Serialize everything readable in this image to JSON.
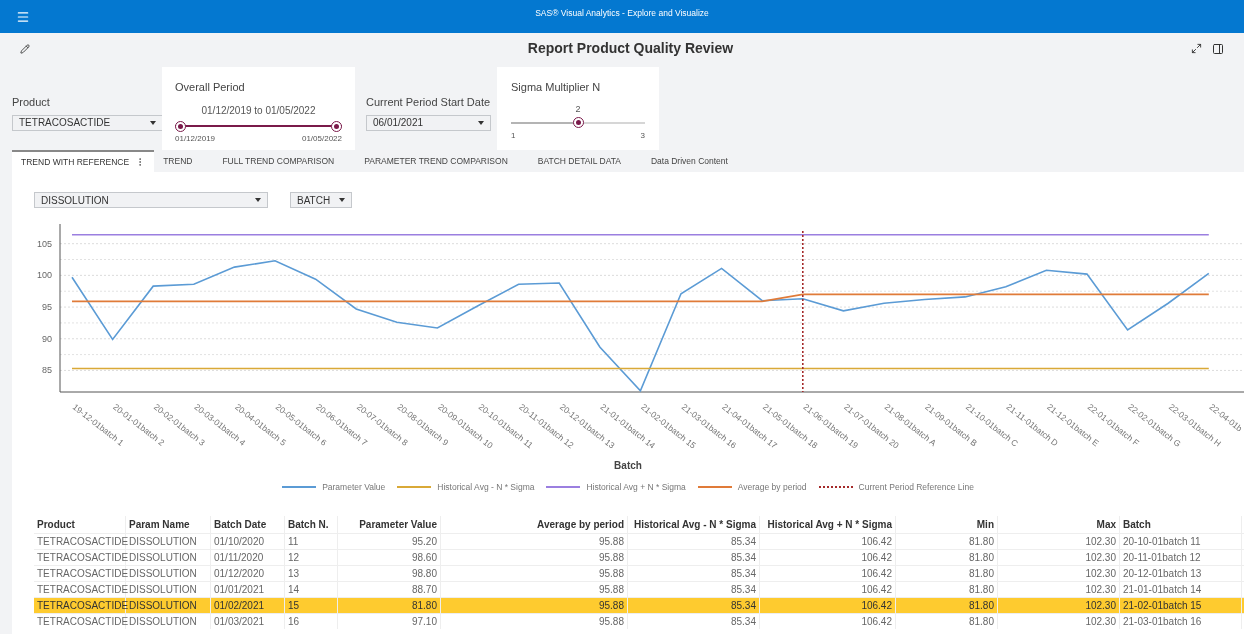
{
  "app_bar": {
    "title": "SAS® Visual Analytics - Explore and Visualize"
  },
  "report": {
    "title": "Report Product Quality Review"
  },
  "filters": {
    "product": {
      "label": "Product",
      "value": "TETRACOSACTIDE"
    },
    "overall_period": {
      "label": "Overall Period",
      "reading": "01/12/2019 to 01/05/2022",
      "min_label": "01/12/2019",
      "max_label": "01/05/2022",
      "level": 1
    },
    "current_period": {
      "label": "Current Period Start Date",
      "value": "06/01/2021"
    },
    "sigma": {
      "label": "Sigma Multiplier N",
      "reading": "2",
      "min_label": "1",
      "max_label": "3",
      "level": 0.5
    }
  },
  "tabs": [
    {
      "label": "TREND WITH REFERENCE",
      "selected": true
    },
    {
      "label": "TREND",
      "selected": false
    },
    {
      "label": "FULL TREND COMPARISON",
      "selected": false
    },
    {
      "label": "PARAMETER TREND COMPARISON",
      "selected": false
    },
    {
      "label": "BATCH DETAIL DATA",
      "selected": false
    },
    {
      "label": "Data Driven Content",
      "selected": false
    }
  ],
  "controls": {
    "parameter": "DISSOLUTION",
    "group_by": "BATCH"
  },
  "chart": {
    "chart_data": {
      "type": "line",
      "xlabel": "Batch",
      "categories": [
        "19-12-01batch 1",
        "20-01-01batch 2",
        "20-02-01batch 3",
        "20-03-01batch 4",
        "20-04-01batch 5",
        "20-05-01batch 6",
        "20-06-01batch 7",
        "20-07-01batch 8",
        "20-08-01batch 9",
        "20-09-01batch 10",
        "20-10-01batch 11",
        "20-11-01batch 12",
        "20-12-01batch 13",
        "21-01-01batch 14",
        "21-02-01batch 15",
        "21-03-01batch 16",
        "21-04-01batch 17",
        "21-05-01batch 18",
        "21-06-01batch 19",
        "21-07-01batch 20",
        "21-08-01batch A",
        "21-09-01batch B",
        "21-10-01batch C",
        "21-11-01batch D",
        "21-12-01batch E",
        "22-01-01batch F",
        "22-02-01batch G",
        "22-03-01batch H",
        "22-04-01b"
      ],
      "series": [
        {
          "name": "Parameter Value",
          "color": "#5b9bd5",
          "values": [
            99.7,
            89.9,
            98.3,
            98.6,
            101.3,
            102.3,
            99.4,
            94.7,
            92.6,
            91.7,
            95.2,
            98.6,
            98.8,
            88.7,
            81.8,
            97.1,
            101.1,
            96.0,
            96.3,
            94.4,
            95.6,
            96.2,
            96.6,
            98.2,
            100.8,
            100.2,
            91.4,
            95.6,
            100.3
          ]
        },
        {
          "name": "Historical Avg - N * Sigma",
          "color": "#d9a937",
          "values": [
            85.3,
            85.3,
            85.3,
            85.3,
            85.3,
            85.3,
            85.3,
            85.3,
            85.3,
            85.3,
            85.3,
            85.3,
            85.3,
            85.3,
            85.3,
            85.3,
            85.3,
            85.3,
            85.3,
            85.3,
            85.3,
            85.3,
            85.3,
            85.3,
            85.3,
            85.3,
            85.3,
            85.3,
            85.3
          ]
        },
        {
          "name": "Historical Avg + N * Sigma",
          "color": "#9b7fe0",
          "values": [
            106.4,
            106.4,
            106.4,
            106.4,
            106.4,
            106.4,
            106.4,
            106.4,
            106.4,
            106.4,
            106.4,
            106.4,
            106.4,
            106.4,
            106.4,
            106.4,
            106.4,
            106.4,
            106.4,
            106.4,
            106.4,
            106.4,
            106.4,
            106.4,
            106.4,
            106.4,
            106.4,
            106.4,
            106.4
          ]
        },
        {
          "name": "Average by period",
          "color": "#e07b39",
          "values": [
            95.9,
            95.9,
            95.9,
            95.9,
            95.9,
            95.9,
            95.9,
            95.9,
            95.9,
            95.9,
            95.9,
            95.9,
            95.9,
            95.9,
            95.9,
            95.9,
            95.9,
            95.9,
            97.0,
            97.0,
            97.0,
            97.0,
            97.0,
            97.0,
            97.0,
            97.0,
            97.0,
            97.0,
            97.0
          ]
        }
      ],
      "ylim": [
        81.6,
        107
      ],
      "yticks": [
        85,
        90,
        95,
        100,
        105
      ],
      "grid": true,
      "legend": true,
      "ref_lines": [
        {
          "axis": "x",
          "value": "21-06-01batch 19",
          "label": "Current Period Reference Line",
          "color": "#a52a2a"
        }
      ]
    }
  },
  "table": {
    "columns": [
      {
        "label": "Product",
        "kind": "text"
      },
      {
        "label": "Param Name",
        "kind": "text"
      },
      {
        "label": "Batch Date",
        "kind": "text"
      },
      {
        "label": "Batch N.",
        "kind": "text"
      },
      {
        "label": "Parameter Value",
        "kind": "number"
      },
      {
        "label": "Average by period",
        "kind": "number"
      },
      {
        "label": "Historical Avg - N * Sigma",
        "kind": "number"
      },
      {
        "label": "Historical Avg + N * Sigma",
        "kind": "number"
      },
      {
        "label": "Min",
        "kind": "number"
      },
      {
        "label": "Max",
        "kind": "number"
      },
      {
        "label": "Batch",
        "kind": "text"
      }
    ],
    "rows": [
      {
        "selected": false,
        "cells": [
          "TETRACOSACTIDE",
          "DISSOLUTION",
          "01/10/2020",
          "11",
          "95.20",
          "95.88",
          "85.34",
          "106.42",
          "81.80",
          "102.30",
          "20-10-01batch 11"
        ]
      },
      {
        "selected": false,
        "cells": [
          "TETRACOSACTIDE",
          "DISSOLUTION",
          "01/11/2020",
          "12",
          "98.60",
          "95.88",
          "85.34",
          "106.42",
          "81.80",
          "102.30",
          "20-11-01batch 12"
        ]
      },
      {
        "selected": false,
        "cells": [
          "TETRACOSACTIDE",
          "DISSOLUTION",
          "01/12/2020",
          "13",
          "98.80",
          "95.88",
          "85.34",
          "106.42",
          "81.80",
          "102.30",
          "20-12-01batch 13"
        ]
      },
      {
        "selected": false,
        "cells": [
          "TETRACOSACTIDE",
          "DISSOLUTION",
          "01/01/2021",
          "14",
          "88.70",
          "95.88",
          "85.34",
          "106.42",
          "81.80",
          "102.30",
          "21-01-01batch 14"
        ]
      },
      {
        "selected": true,
        "cells": [
          "TETRACOSACTIDE",
          "DISSOLUTION",
          "01/02/2021",
          "15",
          "81.80",
          "95.88",
          "85.34",
          "106.42",
          "81.80",
          "102.30",
          "21-02-01batch 15"
        ]
      },
      {
        "selected": false,
        "cells": [
          "TETRACOSACTIDE",
          "DISSOLUTION",
          "01/03/2021",
          "16",
          "97.10",
          "95.88",
          "85.34",
          "106.42",
          "81.80",
          "102.30",
          "21-03-01batch 16"
        ]
      }
    ]
  }
}
